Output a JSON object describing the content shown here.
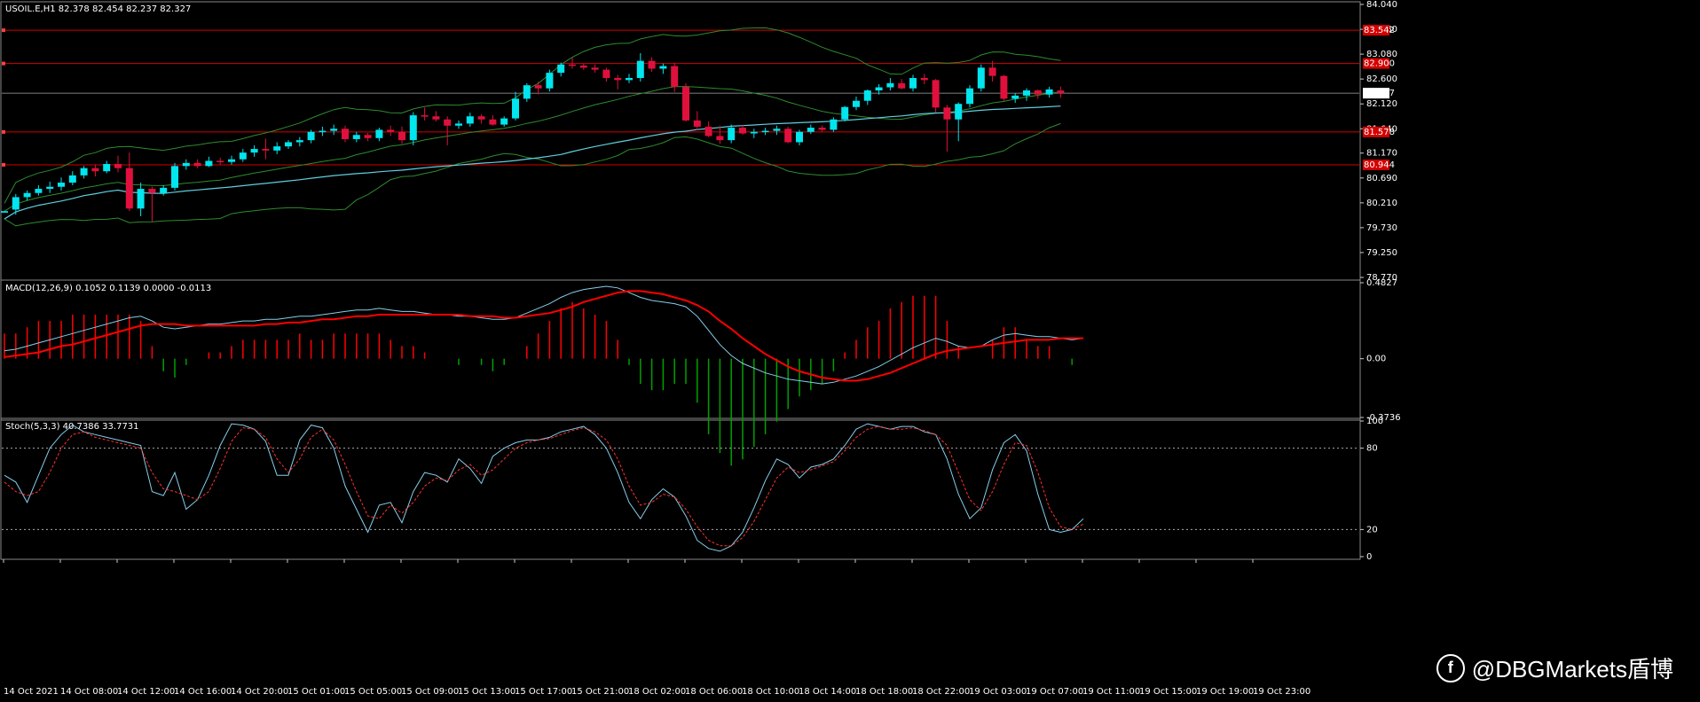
{
  "colors": {
    "bg": "#000000",
    "bull_candle": "#00e5ee",
    "bear_candle": "#e0103c",
    "grid_frame": "#ffffff",
    "bands": "#2e8b2e",
    "ma_line": "#5fcfe0",
    "hline": "#d40000",
    "macd_main": "#87ceeb",
    "macd_signal": "#ff0000",
    "hist_pos": "#ff0000",
    "hist_neg": "#00a000",
    "stoch_main": "#87ceeb",
    "stoch_signal": "#ff3030"
  },
  "chart_data": [
    {
      "type": "candlestick",
      "title": "USOIL.E,H1  82.378 82.454 82.237 82.327",
      "y_ticks": [
        "84.040",
        "83.560",
        "83.080",
        "82.600",
        "82.120",
        "81.640",
        "81.170",
        "80.690",
        "80.210",
        "79.730",
        "79.250",
        "78.770"
      ],
      "ylim": [
        78.77,
        84.04
      ],
      "current_price": "82.327",
      "horizontal_levels": [
        {
          "label": "83.542",
          "value": 83.542
        },
        {
          "label": "82.900",
          "value": 82.9
        },
        {
          "label": "81.578",
          "value": 81.578
        },
        {
          "label": "80.944",
          "value": 80.944
        }
      ],
      "candles": [
        [
          80.02,
          80.02,
          80.02,
          80.05
        ],
        [
          80.08,
          80.38,
          79.98,
          80.32
        ],
        [
          80.32,
          80.45,
          80.25,
          80.4
        ],
        [
          80.4,
          80.55,
          80.35,
          80.48
        ],
        [
          80.48,
          80.62,
          80.4,
          80.52
        ],
        [
          80.52,
          80.7,
          80.45,
          80.6
        ],
        [
          80.6,
          80.82,
          80.55,
          80.74
        ],
        [
          80.74,
          80.92,
          80.68,
          80.88
        ],
        [
          80.88,
          80.95,
          80.72,
          80.82
        ],
        [
          80.82,
          81.02,
          80.78,
          80.96
        ],
        [
          80.96,
          81.12,
          80.8,
          80.88
        ],
        [
          80.88,
          81.18,
          80.05,
          80.1
        ],
        [
          80.1,
          80.6,
          79.95,
          80.48
        ],
        [
          80.48,
          80.52,
          79.85,
          80.4
        ],
        [
          80.4,
          80.55,
          80.35,
          80.5
        ],
        [
          80.5,
          80.98,
          80.45,
          80.92
        ],
        [
          80.92,
          81.05,
          80.85,
          80.98
        ],
        [
          80.98,
          81.05,
          80.88,
          80.92
        ],
        [
          80.92,
          81.1,
          80.9,
          81.02
        ],
        [
          81.02,
          81.08,
          80.95,
          81.0
        ],
        [
          81.0,
          81.12,
          80.95,
          81.05
        ],
        [
          81.05,
          81.25,
          81.0,
          81.18
        ],
        [
          81.18,
          81.32,
          81.1,
          81.25
        ],
        [
          81.25,
          81.45,
          81.05,
          81.22
        ],
        [
          81.22,
          81.38,
          81.15,
          81.3
        ],
        [
          81.3,
          81.42,
          81.25,
          81.38
        ],
        [
          81.38,
          81.48,
          81.3,
          81.42
        ],
        [
          81.42,
          81.62,
          81.36,
          81.58
        ],
        [
          81.58,
          81.68,
          81.5,
          81.6
        ],
        [
          81.6,
          81.72,
          81.52,
          81.64
        ],
        [
          81.64,
          81.7,
          81.38,
          81.44
        ],
        [
          81.44,
          81.58,
          81.38,
          81.52
        ],
        [
          81.52,
          81.56,
          81.4,
          81.46
        ],
        [
          81.46,
          81.66,
          81.4,
          81.62
        ],
        [
          81.62,
          81.7,
          81.5,
          81.58
        ],
        [
          81.58,
          81.68,
          81.35,
          81.42
        ],
        [
          81.42,
          81.96,
          81.32,
          81.9
        ],
        [
          81.9,
          82.05,
          81.8,
          81.88
        ],
        [
          81.88,
          81.98,
          81.78,
          81.82
        ],
        [
          81.82,
          81.88,
          81.32,
          81.7
        ],
        [
          81.7,
          81.8,
          81.64,
          81.74
        ],
        [
          81.74,
          81.95,
          81.68,
          81.88
        ],
        [
          81.88,
          81.92,
          81.74,
          81.82
        ],
        [
          81.82,
          81.9,
          81.7,
          81.72
        ],
        [
          81.72,
          81.88,
          81.68,
          81.84
        ],
        [
          81.84,
          82.35,
          81.8,
          82.22
        ],
        [
          82.22,
          82.52,
          82.16,
          82.48
        ],
        [
          82.48,
          82.55,
          82.3,
          82.42
        ],
        [
          82.42,
          82.78,
          82.36,
          82.72
        ],
        [
          82.72,
          82.92,
          82.65,
          82.88
        ],
        [
          82.88,
          83.02,
          82.8,
          82.86
        ],
        [
          82.86,
          82.9,
          82.78,
          82.82
        ],
        [
          82.82,
          82.88,
          82.72,
          82.78
        ],
        [
          82.78,
          82.82,
          82.55,
          82.62
        ],
        [
          82.62,
          82.68,
          82.4,
          82.58
        ],
        [
          82.58,
          82.7,
          82.52,
          82.62
        ],
        [
          82.62,
          83.1,
          82.55,
          82.95
        ],
        [
          82.95,
          83.02,
          82.74,
          82.8
        ],
        [
          82.8,
          82.9,
          82.7,
          82.85
        ],
        [
          82.85,
          82.92,
          82.35,
          82.45
        ],
        [
          82.45,
          82.52,
          81.78,
          81.8
        ],
        [
          81.8,
          81.98,
          81.62,
          81.68
        ],
        [
          81.68,
          81.78,
          81.48,
          81.5
        ],
        [
          81.5,
          81.7,
          81.35,
          81.42
        ],
        [
          81.42,
          81.72,
          81.36,
          81.66
        ],
        [
          81.66,
          81.72,
          81.52,
          81.55
        ],
        [
          81.55,
          81.64,
          81.46,
          81.58
        ],
        [
          81.58,
          81.66,
          81.52,
          81.6
        ],
        [
          81.6,
          81.7,
          81.52,
          81.64
        ],
        [
          81.64,
          81.68,
          81.36,
          81.38
        ],
        [
          81.38,
          81.62,
          81.32,
          81.58
        ],
        [
          81.58,
          81.72,
          81.54,
          81.66
        ],
        [
          81.66,
          81.7,
          81.58,
          81.62
        ],
        [
          81.62,
          81.86,
          81.58,
          81.82
        ],
        [
          81.82,
          82.08,
          81.78,
          82.06
        ],
        [
          82.06,
          82.26,
          82.0,
          82.18
        ],
        [
          82.18,
          82.4,
          82.1,
          82.38
        ],
        [
          82.38,
          82.5,
          82.3,
          82.44
        ],
        [
          82.44,
          82.62,
          82.38,
          82.52
        ],
        [
          82.52,
          82.6,
          82.4,
          82.42
        ],
        [
          82.42,
          82.68,
          82.36,
          82.62
        ],
        [
          82.62,
          82.7,
          82.5,
          82.58
        ],
        [
          82.58,
          82.6,
          81.95,
          82.05
        ],
        [
          82.05,
          82.1,
          81.2,
          81.82
        ],
        [
          81.82,
          82.15,
          81.4,
          82.12
        ],
        [
          82.12,
          82.48,
          82.05,
          82.42
        ],
        [
          82.42,
          82.88,
          82.36,
          82.82
        ],
        [
          82.82,
          82.95,
          82.55,
          82.66
        ],
        [
          82.66,
          82.68,
          82.18,
          82.22
        ],
        [
          82.22,
          82.32,
          82.14,
          82.28
        ],
        [
          82.28,
          82.42,
          82.18,
          82.38
        ],
        [
          82.38,
          82.4,
          82.22,
          82.3
        ],
        [
          82.3,
          82.45,
          82.24,
          82.4
        ],
        [
          82.378,
          82.454,
          82.237,
          82.327
        ]
      ]
    },
    {
      "type": "line",
      "title": "MACD(12,26,9) 0.1052 0.1139 0.0000 -0.0113",
      "y_ticks": [
        "0.4827",
        "0.00",
        "-0.3736"
      ],
      "ylim": [
        -0.3736,
        0.4827
      ],
      "series": [
        {
          "name": "MACD",
          "values": [
            0.05,
            0.06,
            0.08,
            0.1,
            0.12,
            0.14,
            0.16,
            0.18,
            0.2,
            0.22,
            0.24,
            0.26,
            0.27,
            0.24,
            0.2,
            0.19,
            0.2,
            0.21,
            0.22,
            0.22,
            0.23,
            0.24,
            0.24,
            0.25,
            0.25,
            0.26,
            0.27,
            0.27,
            0.28,
            0.29,
            0.3,
            0.31,
            0.31,
            0.32,
            0.31,
            0.3,
            0.3,
            0.29,
            0.28,
            0.28,
            0.27,
            0.27,
            0.26,
            0.25,
            0.25,
            0.26,
            0.29,
            0.32,
            0.35,
            0.39,
            0.42,
            0.44,
            0.45,
            0.46,
            0.45,
            0.42,
            0.39,
            0.37,
            0.36,
            0.35,
            0.33,
            0.27,
            0.18,
            0.09,
            0.02,
            -0.03,
            -0.06,
            -0.09,
            -0.11,
            -0.13,
            -0.14,
            -0.15,
            -0.16,
            -0.15,
            -0.13,
            -0.11,
            -0.08,
            -0.05,
            -0.01,
            0.03,
            0.07,
            0.1,
            0.13,
            0.11,
            0.08,
            0.07,
            0.08,
            0.12,
            0.15,
            0.16,
            0.15,
            0.14,
            0.14,
            0.13,
            0.12,
            0.13
          ]
        },
        {
          "name": "Signal",
          "values": [
            0.01,
            0.02,
            0.03,
            0.04,
            0.06,
            0.08,
            0.09,
            0.11,
            0.13,
            0.15,
            0.17,
            0.19,
            0.21,
            0.22,
            0.22,
            0.22,
            0.21,
            0.21,
            0.21,
            0.21,
            0.21,
            0.21,
            0.21,
            0.22,
            0.22,
            0.23,
            0.23,
            0.24,
            0.25,
            0.25,
            0.26,
            0.27,
            0.27,
            0.28,
            0.28,
            0.28,
            0.28,
            0.28,
            0.28,
            0.28,
            0.28,
            0.27,
            0.27,
            0.27,
            0.26,
            0.26,
            0.27,
            0.28,
            0.29,
            0.31,
            0.33,
            0.36,
            0.38,
            0.4,
            0.42,
            0.43,
            0.43,
            0.42,
            0.41,
            0.39,
            0.37,
            0.34,
            0.3,
            0.24,
            0.19,
            0.13,
            0.08,
            0.03,
            -0.01,
            -0.05,
            -0.08,
            -0.1,
            -0.12,
            -0.13,
            -0.14,
            -0.14,
            -0.13,
            -0.11,
            -0.09,
            -0.06,
            -0.03,
            0.0,
            0.03,
            0.05,
            0.06,
            0.07,
            0.08,
            0.09,
            0.1,
            0.11,
            0.12,
            0.12,
            0.12,
            0.13,
            0.13,
            0.13
          ]
        }
      ]
    },
    {
      "type": "line",
      "title": "Stoch(5,3,3) 40.7386 33.7731",
      "y_ticks": [
        "100",
        "80",
        "20",
        "0"
      ],
      "ylim": [
        0,
        100
      ],
      "levels": [
        80,
        20
      ],
      "series": [
        {
          "name": "%K",
          "values": [
            60,
            55,
            40,
            60,
            80,
            90,
            97,
            92,
            90,
            88,
            86,
            84,
            82,
            48,
            45,
            62,
            35,
            42,
            60,
            82,
            98,
            97,
            94,
            85,
            60,
            60,
            86,
            97,
            95,
            80,
            52,
            35,
            18,
            38,
            40,
            25,
            48,
            62,
            60,
            55,
            72,
            65,
            54,
            74,
            80,
            84,
            86,
            86,
            88,
            92,
            94,
            96,
            90,
            80,
            62,
            40,
            28,
            42,
            50,
            44,
            30,
            12,
            6,
            4,
            8,
            18,
            36,
            56,
            72,
            68,
            58,
            66,
            68,
            72,
            82,
            94,
            98,
            96,
            94,
            96,
            96,
            92,
            90,
            72,
            46,
            28,
            36,
            64,
            84,
            90,
            78,
            46,
            20,
            18,
            20,
            28
          ]
        },
        {
          "name": "%D",
          "values": [
            55,
            48,
            45,
            48,
            62,
            80,
            90,
            92,
            88,
            86,
            84,
            82,
            80,
            62,
            50,
            48,
            45,
            42,
            48,
            65,
            85,
            95,
            94,
            88,
            72,
            62,
            72,
            88,
            94,
            86,
            68,
            48,
            30,
            28,
            38,
            32,
            40,
            52,
            58,
            56,
            64,
            68,
            60,
            64,
            72,
            80,
            84,
            86,
            87,
            90,
            93,
            95,
            92,
            86,
            72,
            52,
            38,
            40,
            46,
            44,
            35,
            22,
            12,
            8,
            8,
            14,
            26,
            42,
            58,
            66,
            62,
            64,
            67,
            70,
            78,
            88,
            94,
            96,
            94,
            94,
            95,
            93,
            90,
            82,
            62,
            42,
            34,
            48,
            68,
            84,
            82,
            62,
            36,
            22,
            20,
            24
          ]
        }
      ]
    }
  ],
  "x_ticks": [
    "14 Oct 2021",
    "14 Oct 08:00",
    "14 Oct 12:00",
    "14 Oct 16:00",
    "14 Oct 20:00",
    "15 Oct 01:00",
    "15 Oct 05:00",
    "15 Oct 09:00",
    "15 Oct 13:00",
    "15 Oct 17:00",
    "15 Oct 21:00",
    "18 Oct 02:00",
    "18 Oct 06:00",
    "18 Oct 10:00",
    "18 Oct 14:00",
    "18 Oct 18:00",
    "18 Oct 22:00",
    "19 Oct 03:00",
    "19 Oct 07:00",
    "19 Oct 11:00",
    "19 Oct 15:00",
    "19 Oct 19:00",
    "19 Oct 23:00"
  ],
  "watermark": {
    "logo": "f",
    "text": "@DBGMarkets盾博"
  }
}
